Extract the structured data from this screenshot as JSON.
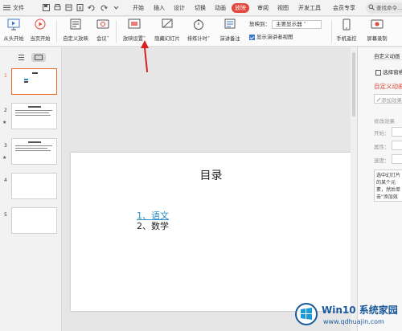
{
  "menubar": {
    "file": "文件",
    "tabs": [
      "开始",
      "插入",
      "设计",
      "切换",
      "动画",
      "放映",
      "审阅",
      "视图",
      "开发工具",
      "会员专享"
    ],
    "active_tab": "放映",
    "search_placeholder": "查找命令..."
  },
  "ribbon": {
    "from_start": "从头开始",
    "from_current": "当页开始",
    "custom_show": "自定义放映",
    "meeting": "会议",
    "show_settings": "放映设置",
    "hide_slide": "隐藏幻灯片",
    "rehearse": "排练计时",
    "speaker_notes": "演讲备注",
    "show_on_label": "放映到：",
    "show_on_value": "主要显示器",
    "presenter_view": "显示演讲者视图",
    "phone_remote": "手机遥控",
    "screen_record": "屏幕录制"
  },
  "slides": {
    "numbers": [
      "1",
      "2",
      "3",
      "4",
      "5"
    ],
    "star": "★"
  },
  "main_slide": {
    "title": "目录",
    "item1": "1、语文",
    "item2": "2、数学"
  },
  "right_panel": {
    "title": "自定义动画",
    "select_pane": "选择窗格",
    "custom_anim": "自定义动画",
    "add_effect": "添加效果",
    "modify_effect": "修改效果",
    "start": "开始：",
    "property": "属性：",
    "speed": "速度：",
    "description": "选中幻灯片的某个元素，然后单击\"添加效果\""
  },
  "watermark": {
    "brand": "Win10 系统家园",
    "url": "www.qdhuajin.com"
  },
  "colors": {
    "accent": "#e0463b",
    "link": "#2a8cc6",
    "selection": "#e76b2c"
  }
}
